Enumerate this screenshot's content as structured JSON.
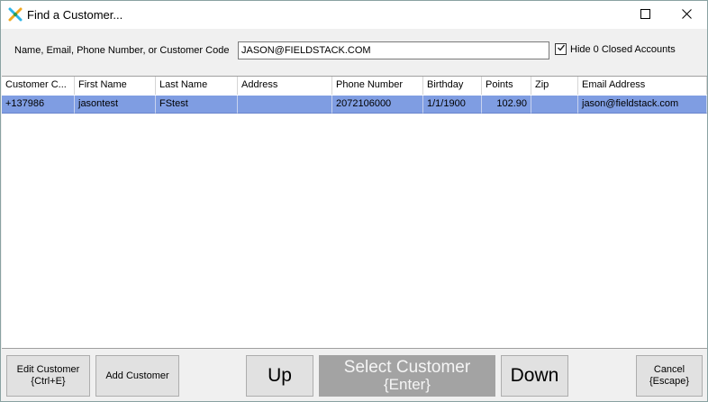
{
  "window": {
    "title": "Find a Customer..."
  },
  "search": {
    "label": "Name, Email, Phone Number, or Customer Code",
    "value": "JASON@FIELDSTACK.COM",
    "hide_closed_label": "Hide 0 Closed Accounts",
    "hide_closed_checked": true
  },
  "grid": {
    "columns": [
      "Customer C...",
      "First Name",
      "Last Name",
      "Address",
      "Phone Number",
      "Birthday",
      "Points",
      "Zip",
      "Email Address"
    ],
    "rows": [
      {
        "customer_code": "+137986",
        "first_name": "jasontest",
        "last_name": "FStest",
        "address": "",
        "phone": "2072106000",
        "birthday": "1/1/1900",
        "points": "102.90",
        "zip": "",
        "email": "jason@fieldstack.com"
      }
    ],
    "selected_row_color": "#7f9de2"
  },
  "buttons": {
    "edit_customer": {
      "line1": "Edit Customer",
      "line2": "{Ctrl+E}"
    },
    "add_customer": {
      "label": "Add Customer"
    },
    "up": {
      "label": "Up"
    },
    "select_customer": {
      "line1": "Select Customer",
      "line2": "{Enter}"
    },
    "down": {
      "label": "Down"
    },
    "cancel": {
      "line1": "Cancel",
      "line2": "{Escape}"
    }
  },
  "icons": {
    "app": "app-logo-icon",
    "maximize": "maximize-icon",
    "close": "close-icon",
    "checkbox": "checkmark-icon"
  }
}
